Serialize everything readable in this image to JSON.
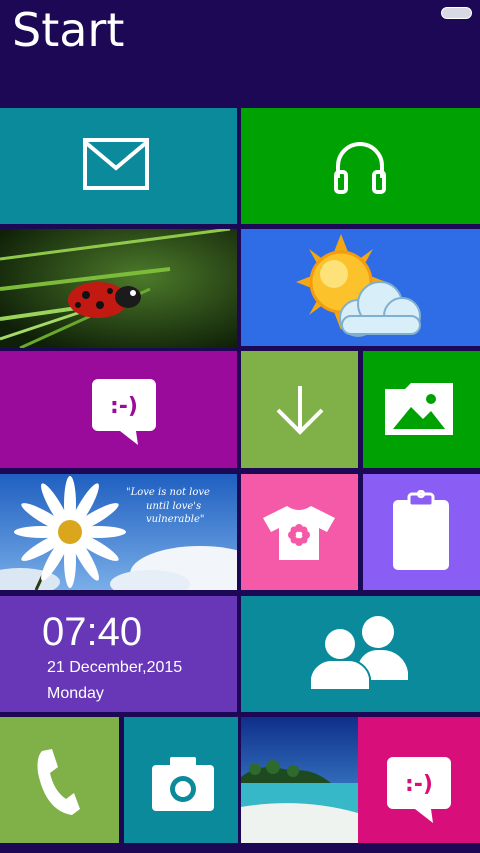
{
  "header": {
    "title": "Start"
  },
  "clock": {
    "time": "07:40",
    "date": "21 December,2015",
    "day": "Monday"
  },
  "quote": {
    "line1": "\"Love is not love",
    "line2": "until love's vulnerable\""
  },
  "tiles": {
    "mail": {
      "icon": "mail-icon",
      "color": "#0b8a9b"
    },
    "music": {
      "icon": "headphones-icon",
      "color": "#00a203"
    },
    "ladybug_photo": {
      "icon": "ladybug-photo"
    },
    "weather": {
      "icon": "sun-cloud-icon",
      "color": "#2f6de6"
    },
    "messaging": {
      "icon": "message-smiley-icon",
      "color": "#9a0a9b"
    },
    "downloads": {
      "icon": "arrow-down-icon",
      "color": "#7fb148"
    },
    "gallery": {
      "icon": "image-folder-icon",
      "color": "#00a203"
    },
    "daisy_photo": {
      "icon": "daisy-photo"
    },
    "themes": {
      "icon": "tshirt-icon",
      "color": "#f55aa8"
    },
    "clipboard": {
      "icon": "clipboard-icon",
      "color": "#8a5ef5"
    },
    "clock": {
      "color": "#6737b8"
    },
    "contacts": {
      "icon": "people-icon",
      "color": "#0b8a9b"
    },
    "phone": {
      "icon": "phone-icon",
      "color": "#7fb148"
    },
    "camera": {
      "icon": "camera-icon",
      "color": "#0b8a9b"
    },
    "beach_photo": {
      "icon": "beach-photo"
    },
    "messaging2": {
      "icon": "message-smiley-icon",
      "color": "#d80e7a"
    }
  }
}
